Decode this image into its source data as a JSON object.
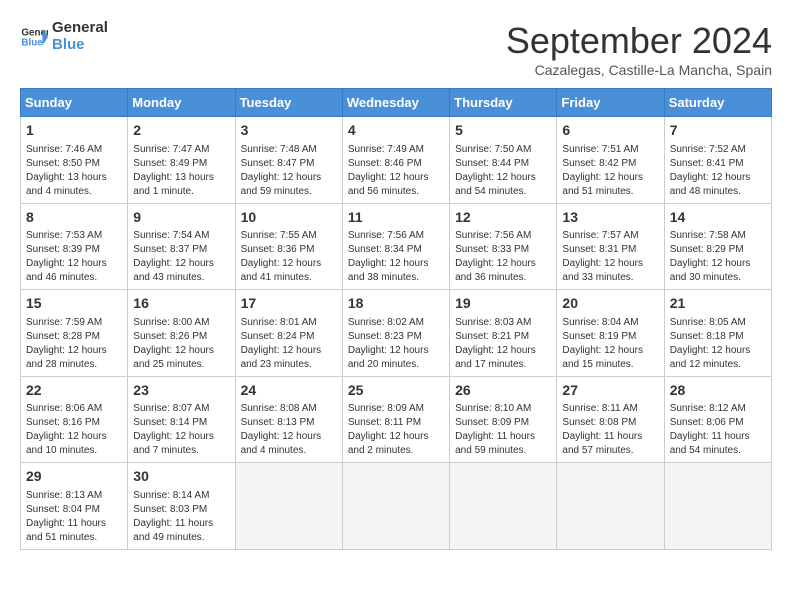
{
  "logo": {
    "line1": "General",
    "line2": "Blue"
  },
  "title": "September 2024",
  "subtitle": "Cazalegas, Castille-La Mancha, Spain",
  "headers": [
    "Sunday",
    "Monday",
    "Tuesday",
    "Wednesday",
    "Thursday",
    "Friday",
    "Saturday"
  ],
  "weeks": [
    [
      {
        "day": "1",
        "info": "Sunrise: 7:46 AM\nSunset: 8:50 PM\nDaylight: 13 hours and 4 minutes."
      },
      {
        "day": "2",
        "info": "Sunrise: 7:47 AM\nSunset: 8:49 PM\nDaylight: 13 hours and 1 minute."
      },
      {
        "day": "3",
        "info": "Sunrise: 7:48 AM\nSunset: 8:47 PM\nDaylight: 12 hours and 59 minutes."
      },
      {
        "day": "4",
        "info": "Sunrise: 7:49 AM\nSunset: 8:46 PM\nDaylight: 12 hours and 56 minutes."
      },
      {
        "day": "5",
        "info": "Sunrise: 7:50 AM\nSunset: 8:44 PM\nDaylight: 12 hours and 54 minutes."
      },
      {
        "day": "6",
        "info": "Sunrise: 7:51 AM\nSunset: 8:42 PM\nDaylight: 12 hours and 51 minutes."
      },
      {
        "day": "7",
        "info": "Sunrise: 7:52 AM\nSunset: 8:41 PM\nDaylight: 12 hours and 48 minutes."
      }
    ],
    [
      {
        "day": "8",
        "info": "Sunrise: 7:53 AM\nSunset: 8:39 PM\nDaylight: 12 hours and 46 minutes."
      },
      {
        "day": "9",
        "info": "Sunrise: 7:54 AM\nSunset: 8:37 PM\nDaylight: 12 hours and 43 minutes."
      },
      {
        "day": "10",
        "info": "Sunrise: 7:55 AM\nSunset: 8:36 PM\nDaylight: 12 hours and 41 minutes."
      },
      {
        "day": "11",
        "info": "Sunrise: 7:56 AM\nSunset: 8:34 PM\nDaylight: 12 hours and 38 minutes."
      },
      {
        "day": "12",
        "info": "Sunrise: 7:56 AM\nSunset: 8:33 PM\nDaylight: 12 hours and 36 minutes."
      },
      {
        "day": "13",
        "info": "Sunrise: 7:57 AM\nSunset: 8:31 PM\nDaylight: 12 hours and 33 minutes."
      },
      {
        "day": "14",
        "info": "Sunrise: 7:58 AM\nSunset: 8:29 PM\nDaylight: 12 hours and 30 minutes."
      }
    ],
    [
      {
        "day": "15",
        "info": "Sunrise: 7:59 AM\nSunset: 8:28 PM\nDaylight: 12 hours and 28 minutes."
      },
      {
        "day": "16",
        "info": "Sunrise: 8:00 AM\nSunset: 8:26 PM\nDaylight: 12 hours and 25 minutes."
      },
      {
        "day": "17",
        "info": "Sunrise: 8:01 AM\nSunset: 8:24 PM\nDaylight: 12 hours and 23 minutes."
      },
      {
        "day": "18",
        "info": "Sunrise: 8:02 AM\nSunset: 8:23 PM\nDaylight: 12 hours and 20 minutes."
      },
      {
        "day": "19",
        "info": "Sunrise: 8:03 AM\nSunset: 8:21 PM\nDaylight: 12 hours and 17 minutes."
      },
      {
        "day": "20",
        "info": "Sunrise: 8:04 AM\nSunset: 8:19 PM\nDaylight: 12 hours and 15 minutes."
      },
      {
        "day": "21",
        "info": "Sunrise: 8:05 AM\nSunset: 8:18 PM\nDaylight: 12 hours and 12 minutes."
      }
    ],
    [
      {
        "day": "22",
        "info": "Sunrise: 8:06 AM\nSunset: 8:16 PM\nDaylight: 12 hours and 10 minutes."
      },
      {
        "day": "23",
        "info": "Sunrise: 8:07 AM\nSunset: 8:14 PM\nDaylight: 12 hours and 7 minutes."
      },
      {
        "day": "24",
        "info": "Sunrise: 8:08 AM\nSunset: 8:13 PM\nDaylight: 12 hours and 4 minutes."
      },
      {
        "day": "25",
        "info": "Sunrise: 8:09 AM\nSunset: 8:11 PM\nDaylight: 12 hours and 2 minutes."
      },
      {
        "day": "26",
        "info": "Sunrise: 8:10 AM\nSunset: 8:09 PM\nDaylight: 11 hours and 59 minutes."
      },
      {
        "day": "27",
        "info": "Sunrise: 8:11 AM\nSunset: 8:08 PM\nDaylight: 11 hours and 57 minutes."
      },
      {
        "day": "28",
        "info": "Sunrise: 8:12 AM\nSunset: 8:06 PM\nDaylight: 11 hours and 54 minutes."
      }
    ],
    [
      {
        "day": "29",
        "info": "Sunrise: 8:13 AM\nSunset: 8:04 PM\nDaylight: 11 hours and 51 minutes."
      },
      {
        "day": "30",
        "info": "Sunrise: 8:14 AM\nSunset: 8:03 PM\nDaylight: 11 hours and 49 minutes."
      },
      {
        "day": "",
        "info": ""
      },
      {
        "day": "",
        "info": ""
      },
      {
        "day": "",
        "info": ""
      },
      {
        "day": "",
        "info": ""
      },
      {
        "day": "",
        "info": ""
      }
    ]
  ]
}
